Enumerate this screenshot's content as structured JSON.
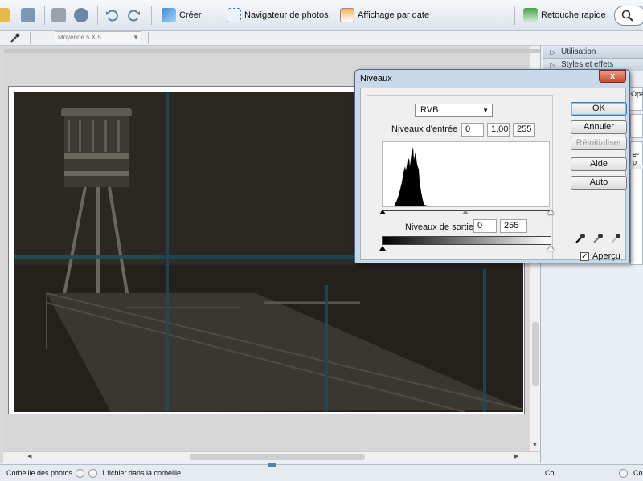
{
  "toolbar": {
    "create_label": "Créer",
    "navigator_label": "Navigateur de photos",
    "date_view_label": "Affichage par date",
    "quick_fix_label": "Retouche rapide"
  },
  "options_bar": {
    "sample_size": "Moyenne 5 X 5"
  },
  "right_panel": {
    "section_use": "Utilisation",
    "section_styles": "Styles et effets",
    "partial_label_1": "Opa",
    "partial_label_2": "e-p"
  },
  "levels_dialog": {
    "title": "Niveaux",
    "close_glyph": "x",
    "channel": "RVB",
    "input_levels_label": "Niveaux d'entrée :",
    "input_black": "0",
    "input_gamma": "1,00",
    "input_white": "255",
    "output_levels_label": "Niveaux de sortie :",
    "output_black": "0",
    "output_white": "255",
    "ok_label": "OK",
    "cancel_label": "Annuler",
    "reset_label": "Réinitialiser",
    "help_label": "Aide",
    "auto_label": "Auto",
    "preview_label": "Aperçu",
    "preview_checked": true
  },
  "bottom_bar": {
    "photo_bin_label": "Corbeille des photos",
    "bin_status": "1 fichier dans la corbeille",
    "right_partial_1": "Co",
    "right_partial_2": "Co"
  },
  "colors": {
    "photo_tint": "#2b2722",
    "guide_line": "#1e4a5a",
    "dialog_frame": "#c9d9ea"
  }
}
